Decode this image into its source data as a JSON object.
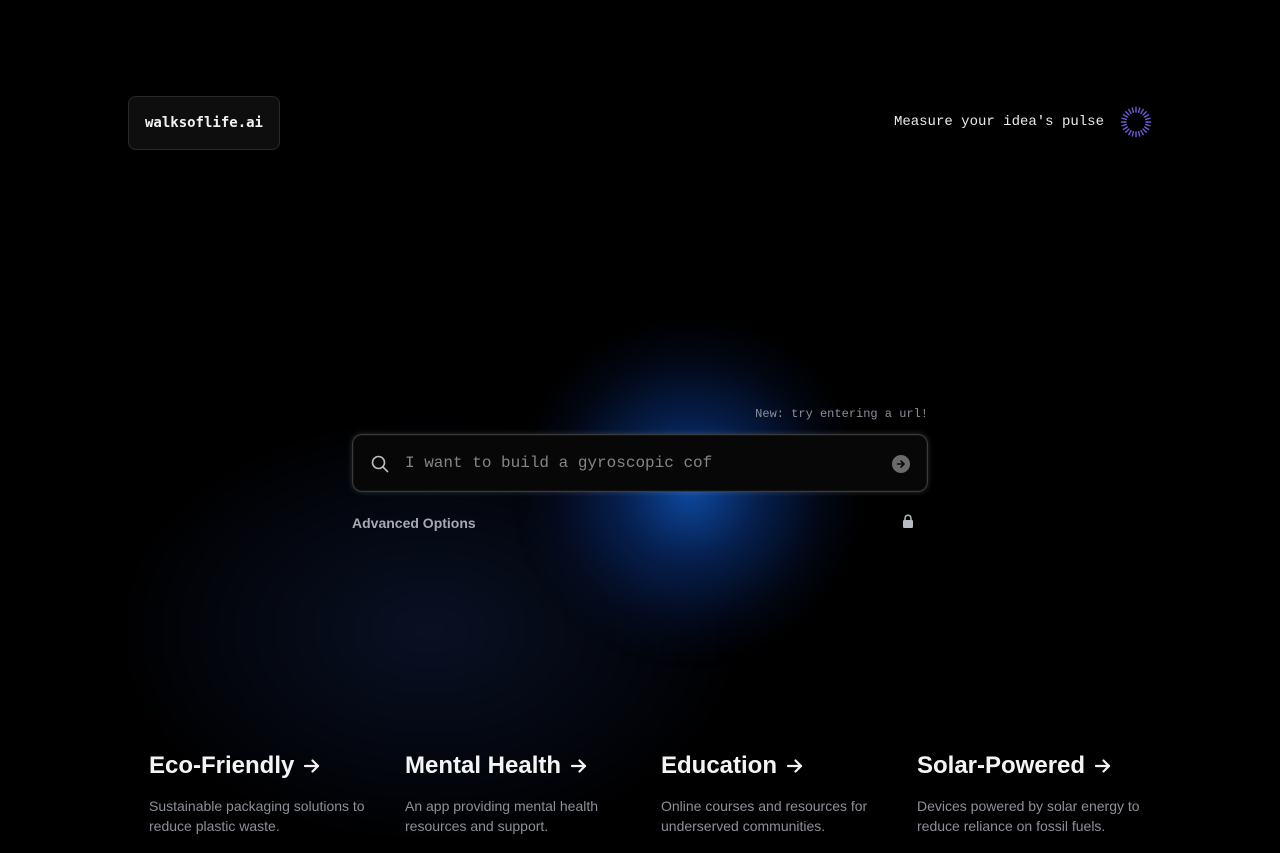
{
  "header": {
    "logo_text": "walksoflife.ai",
    "tagline": "Measure your idea's pulse",
    "pulse_icon": "spinner-ring-icon",
    "pulse_color": "#6a5cd8"
  },
  "search": {
    "hint": "New: try entering a url!",
    "placeholder": "I want to build a gyroscopic cof",
    "value": "",
    "submit_icon": "arrow-right-circle-icon"
  },
  "options": {
    "advanced_label": "Advanced Options",
    "lock_icon": "lock-icon"
  },
  "cards": [
    {
      "title": "Eco-Friendly",
      "arrow": "→",
      "description": "Sustainable packaging solutions to reduce plastic waste."
    },
    {
      "title": "Mental Health",
      "arrow": "→",
      "description": "An app providing mental health resources and support."
    },
    {
      "title": "Education",
      "arrow": "→",
      "description": "Online courses and resources for underserved communities."
    },
    {
      "title": "Solar-Powered",
      "arrow": "→",
      "description": "Devices powered by solar energy to reduce reliance on fossil fuels."
    }
  ],
  "colors": {
    "background": "#000000",
    "glow": "#0e4eaa",
    "text_muted": "#8e9099"
  }
}
